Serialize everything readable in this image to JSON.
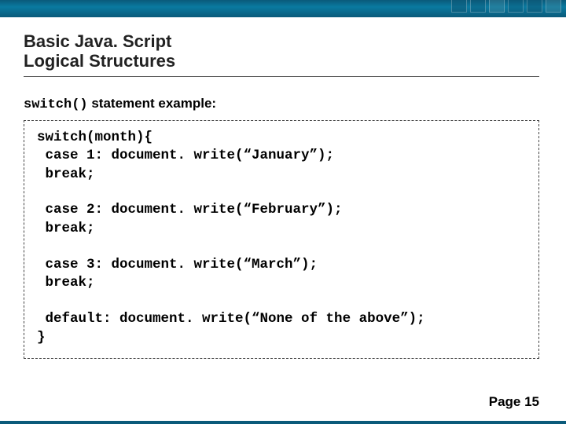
{
  "title_line1": "Basic Java. Script",
  "title_line2": "Logical Structures",
  "subtitle_code": "switch()",
  "subtitle_rest": " statement example:",
  "code": {
    "open": "switch(month){",
    "c1a": " case 1: document. write(“January”);",
    "c1b": " break;",
    "c2a": " case 2: document. write(“February”);",
    "c2b": " break;",
    "c3a": " case 3: document. write(“March”);",
    "c3b": " break;",
    "def": " default: document. write(“None of the above”);",
    "close": "}"
  },
  "footer": "Page 15"
}
